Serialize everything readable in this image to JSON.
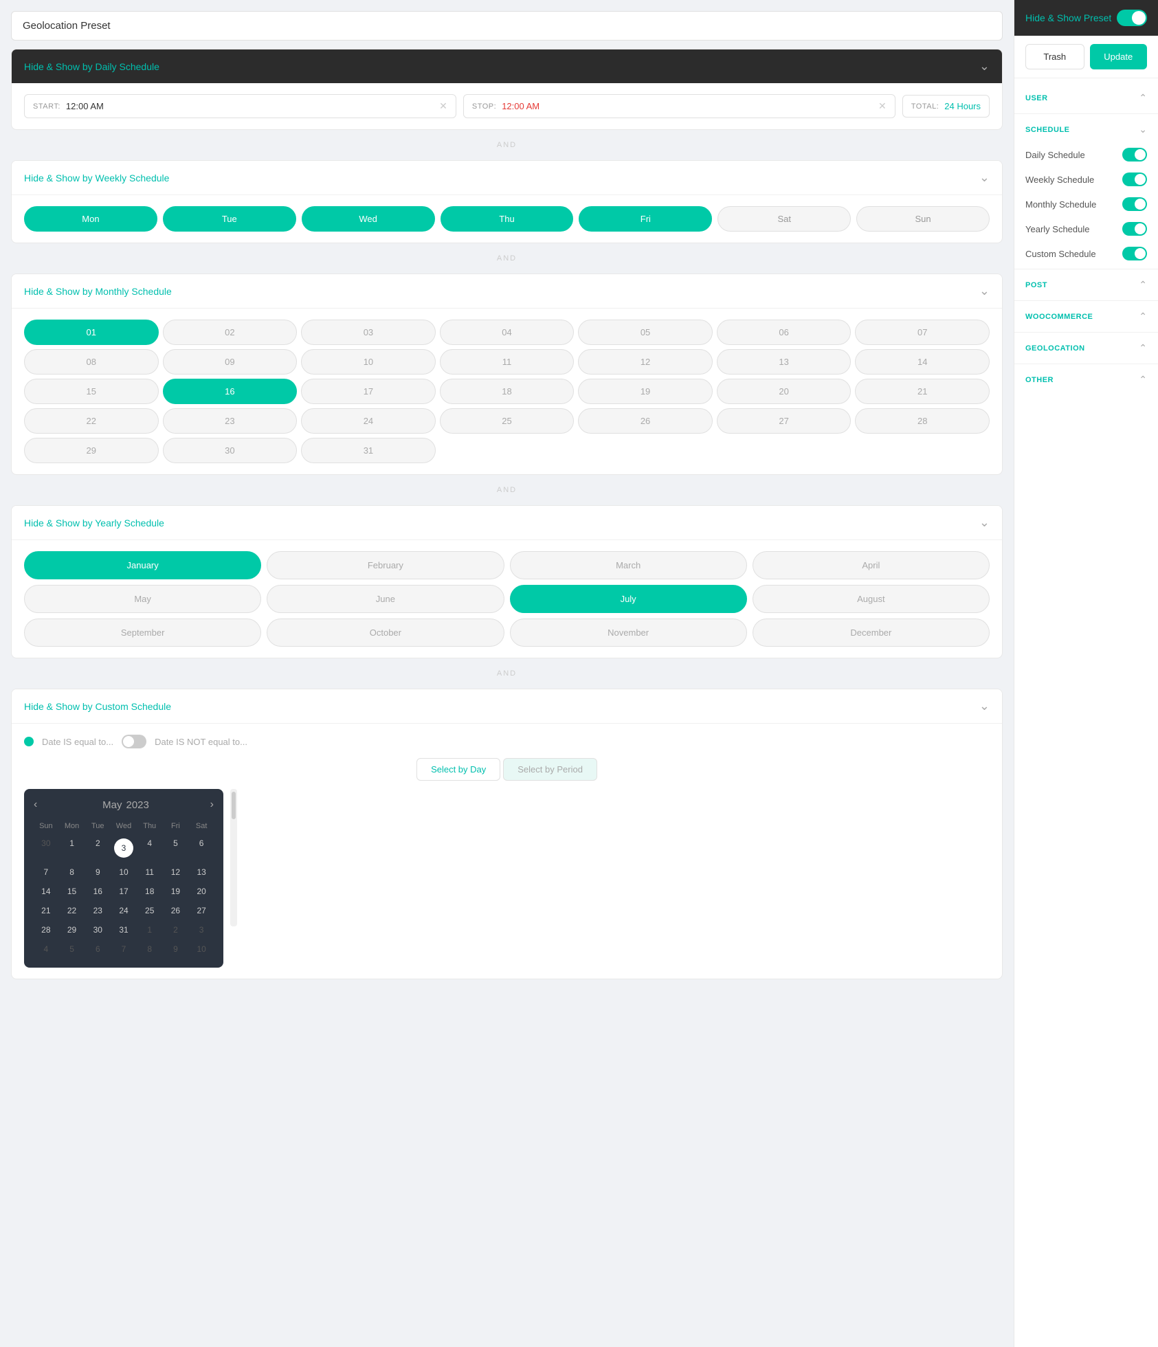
{
  "preset": {
    "title": "Geolocation Preset"
  },
  "right_panel": {
    "header_text": "Hide & Show",
    "header_span": "Preset",
    "trash_label": "Trash",
    "update_label": "Update",
    "sections": [
      {
        "id": "user",
        "label": "USER",
        "expanded": true
      },
      {
        "id": "schedule",
        "label": "SCHEDULE",
        "expanded": true
      },
      {
        "id": "post",
        "label": "POST",
        "expanded": true
      },
      {
        "id": "woocommerce",
        "label": "WOOCOMMERCE",
        "expanded": true
      },
      {
        "id": "geolocation",
        "label": "GEOLOCATION",
        "expanded": true
      },
      {
        "id": "other",
        "label": "OTHER",
        "expanded": true
      }
    ],
    "schedule_items": [
      {
        "label": "Daily Schedule",
        "enabled": true
      },
      {
        "label": "Weekly Schedule",
        "enabled": true
      },
      {
        "label": "Monthly Schedule",
        "enabled": true
      },
      {
        "label": "Yearly Schedule",
        "enabled": true
      },
      {
        "label": "Custom Schedule",
        "enabled": true
      }
    ]
  },
  "daily_schedule": {
    "header": "Hide & Show",
    "header_span": "by Daily Schedule",
    "start_label": "START:",
    "start_value": "12:00 AM",
    "stop_label": "STOP:",
    "stop_value": "12:00 AM",
    "total_label": "TOTAL:",
    "total_value": "24 Hours"
  },
  "weekly_schedule": {
    "header": "Hide & Show",
    "header_span": "by Weekly Schedule",
    "days": [
      {
        "label": "Mon",
        "active": true
      },
      {
        "label": "Tue",
        "active": true
      },
      {
        "label": "Wed",
        "active": true
      },
      {
        "label": "Thu",
        "active": true
      },
      {
        "label": "Fri",
        "active": true
      },
      {
        "label": "Sat",
        "active": false
      },
      {
        "label": "Sun",
        "active": false
      }
    ]
  },
  "monthly_schedule": {
    "header": "Hide & Show",
    "header_span": "by Monthly Schedule",
    "days": [
      "01",
      "02",
      "03",
      "04",
      "05",
      "06",
      "07",
      "08",
      "09",
      "10",
      "11",
      "12",
      "13",
      "14",
      "15",
      "16",
      "17",
      "18",
      "19",
      "20",
      "21",
      "22",
      "23",
      "24",
      "25",
      "26",
      "27",
      "28",
      "29",
      "30",
      "31"
    ],
    "active_days": [
      "01",
      "16"
    ]
  },
  "yearly_schedule": {
    "header": "Hide & Show",
    "header_span": "by Yearly Schedule",
    "months": [
      "January",
      "February",
      "March",
      "April",
      "May",
      "June",
      "July",
      "August",
      "September",
      "October",
      "November",
      "December"
    ],
    "active_months": [
      "January",
      "July"
    ]
  },
  "custom_schedule": {
    "header": "Hide & Show",
    "header_span": "by Custom Schedule",
    "is_equal_label": "Date IS equal to...",
    "is_not_equal_label": "Date IS NOT equal to...",
    "select_by_day": "Select by Day",
    "select_by_period": "Select by Period",
    "calendar": {
      "month": "May",
      "year": "2023",
      "day_headers": [
        "Sun",
        "Mon",
        "Tue",
        "Wed",
        "Thu",
        "Fri",
        "Sat"
      ],
      "weeks": [
        [
          "30",
          "1",
          "2",
          "3",
          "4",
          "5",
          "6"
        ],
        [
          "7",
          "8",
          "9",
          "10",
          "11",
          "12",
          "13"
        ],
        [
          "14",
          "15",
          "16",
          "17",
          "18",
          "19",
          "20"
        ],
        [
          "21",
          "22",
          "23",
          "24",
          "25",
          "26",
          "27"
        ],
        [
          "28",
          "29",
          "30",
          "31",
          "1",
          "2",
          "3"
        ],
        [
          "4",
          "5",
          "6",
          "7",
          "8",
          "9",
          "10"
        ]
      ],
      "active_day": "3",
      "prev_month_days": [
        "30"
      ],
      "next_month_days": [
        "1",
        "2",
        "3",
        "4",
        "5",
        "6",
        "7",
        "8",
        "9",
        "10"
      ]
    }
  },
  "and_separator": "AND"
}
